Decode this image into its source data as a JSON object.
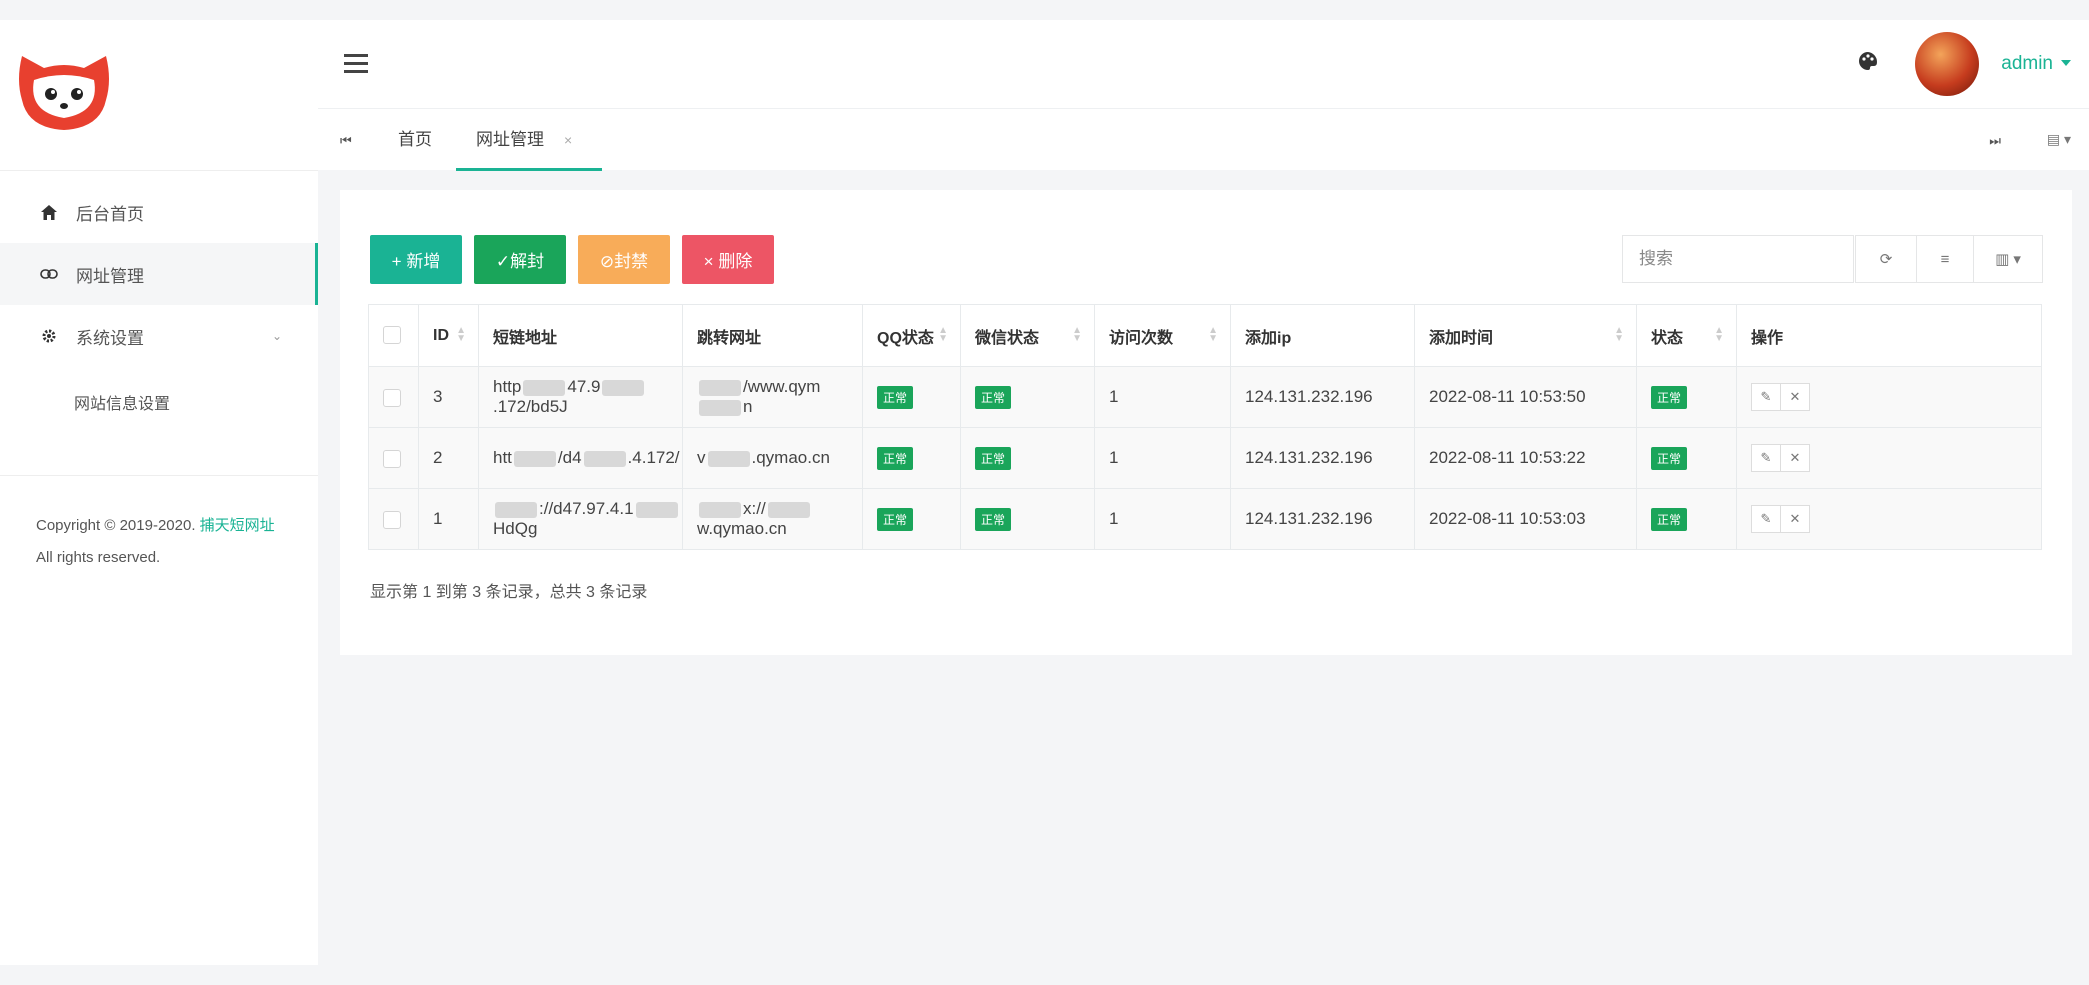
{
  "colors": {
    "accent": "#1ab394",
    "success": "#1aa55a",
    "warning": "#f8ac59",
    "danger": "#ed5565"
  },
  "sidebar": {
    "items": [
      {
        "label": "后台首页",
        "icon": "home-icon"
      },
      {
        "label": "网址管理",
        "icon": "link-icon"
      },
      {
        "label": "系统设置",
        "icon": "gear-icon"
      }
    ],
    "sub_items": [
      {
        "label": "网站信息设置"
      }
    ],
    "copyright": {
      "prefix": "Copyright © 2019-2020. ",
      "brand": "捕天短网址",
      "suffix": " All rights reserved."
    }
  },
  "header": {
    "user": "admin"
  },
  "tabs": {
    "home": "首页",
    "active": "网址管理",
    "close": "×"
  },
  "toolbar": {
    "add": "+ 新增",
    "unlock": "✓解封",
    "ban": "⊘封禁",
    "delete": "× 删除"
  },
  "search": {
    "placeholder": "搜索"
  },
  "table": {
    "headers": [
      "ID",
      "短链地址",
      "跳转网址",
      "QQ状态",
      "微信状态",
      "访问次数",
      "添加ip",
      "添加时间",
      "状态",
      "操作"
    ],
    "rows": [
      {
        "id": "3",
        "short": "http",
        "short2": "47.9",
        "short3": ".172/bd5J",
        "target": "",
        "target2": "/www.qym",
        "target3": "n",
        "qq": "正常",
        "wx": "正常",
        "visits": "1",
        "ip": "124.131.232.196",
        "time": "2022-08-11 10:53:50",
        "status": "正常"
      },
      {
        "id": "2",
        "short": "htt",
        "short2": "/d4",
        "short3": ".4.172/",
        "target": "v",
        "target2": ".qymao.cn",
        "target3": "",
        "qq": "正常",
        "wx": "正常",
        "visits": "1",
        "ip": "124.131.232.196",
        "time": "2022-08-11 10:53:22",
        "status": "正常"
      },
      {
        "id": "1",
        "short": "",
        "short2": "://d47.97.4.1",
        "short3": "HdQg",
        "target": "",
        "target2": "x://",
        "target3": "w.qymao.cn",
        "qq": "正常",
        "wx": "正常",
        "visits": "1",
        "ip": "124.131.232.196",
        "time": "2022-08-11 10:53:03",
        "status": "正常"
      }
    ]
  },
  "pagination": {
    "info": "显示第 1 到第 3 条记录，总共 3 条记录"
  }
}
